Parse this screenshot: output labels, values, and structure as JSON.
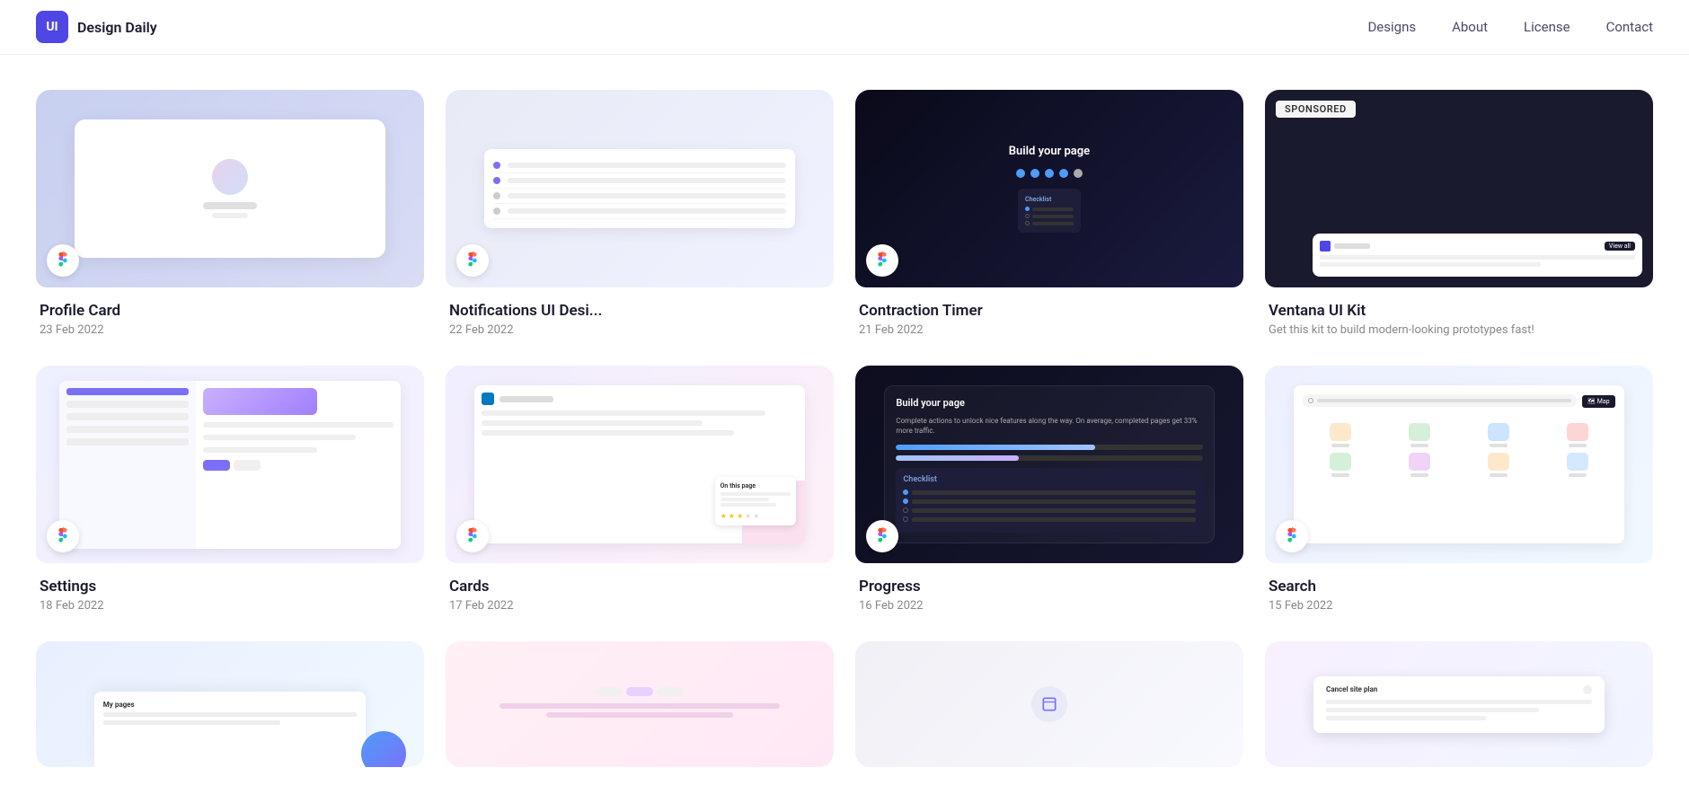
{
  "header": {
    "logo_text": "Design Daily",
    "logo_abbr": "UI",
    "nav": {
      "designs": "Designs",
      "about": "About",
      "license": "License",
      "contact": "Contact"
    }
  },
  "grid_row1": [
    {
      "id": "profile-card",
      "title": "Profile Card",
      "date": "23 Feb 2022",
      "type": "figma"
    },
    {
      "id": "notifications",
      "title": "Notifications UI Desi...",
      "date": "22 Feb 2022",
      "type": "figma"
    },
    {
      "id": "contraction-timer",
      "title": "Contraction Timer",
      "date": "21 Feb 2022",
      "type": "figma"
    },
    {
      "id": "ventana",
      "title": "Ventana UI Kit",
      "date": "",
      "type": "sponsored",
      "sponsored_label": "SPONSORED",
      "sponsored_desc": "Get this kit to build modern-looking prototypes fast!"
    }
  ],
  "grid_row2": [
    {
      "id": "settings",
      "title": "Settings",
      "date": "18 Feb 2022",
      "type": "figma"
    },
    {
      "id": "cards",
      "title": "Cards",
      "date": "17 Feb 2022",
      "type": "figma"
    },
    {
      "id": "progress",
      "title": "Progress",
      "date": "16 Feb 2022",
      "type": "figma"
    },
    {
      "id": "search",
      "title": "Search",
      "date": "15 Feb 2022",
      "type": "figma"
    }
  ],
  "grid_row3": [
    {
      "id": "item-a",
      "title": "",
      "date": "",
      "type": "figma"
    },
    {
      "id": "item-b",
      "title": "",
      "date": "",
      "type": "figma"
    },
    {
      "id": "item-c",
      "title": "",
      "date": "",
      "type": "figma"
    },
    {
      "id": "item-d",
      "title": "",
      "date": "",
      "type": "figma"
    }
  ]
}
